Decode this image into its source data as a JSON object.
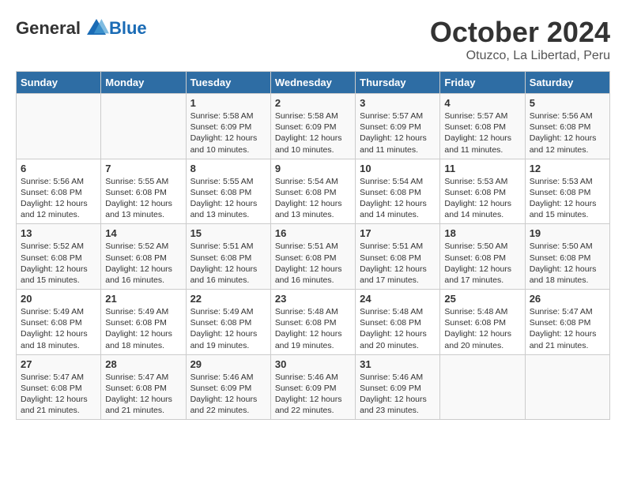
{
  "header": {
    "logo_general": "General",
    "logo_blue": "Blue",
    "month": "October 2024",
    "location": "Otuzco, La Libertad, Peru"
  },
  "days_of_week": [
    "Sunday",
    "Monday",
    "Tuesday",
    "Wednesday",
    "Thursday",
    "Friday",
    "Saturday"
  ],
  "weeks": [
    [
      {
        "day": "",
        "content": ""
      },
      {
        "day": "",
        "content": ""
      },
      {
        "day": "1",
        "content": "Sunrise: 5:58 AM\nSunset: 6:09 PM\nDaylight: 12 hours and 10 minutes."
      },
      {
        "day": "2",
        "content": "Sunrise: 5:58 AM\nSunset: 6:09 PM\nDaylight: 12 hours and 10 minutes."
      },
      {
        "day": "3",
        "content": "Sunrise: 5:57 AM\nSunset: 6:09 PM\nDaylight: 12 hours and 11 minutes."
      },
      {
        "day": "4",
        "content": "Sunrise: 5:57 AM\nSunset: 6:08 PM\nDaylight: 12 hours and 11 minutes."
      },
      {
        "day": "5",
        "content": "Sunrise: 5:56 AM\nSunset: 6:08 PM\nDaylight: 12 hours and 12 minutes."
      }
    ],
    [
      {
        "day": "6",
        "content": "Sunrise: 5:56 AM\nSunset: 6:08 PM\nDaylight: 12 hours and 12 minutes."
      },
      {
        "day": "7",
        "content": "Sunrise: 5:55 AM\nSunset: 6:08 PM\nDaylight: 12 hours and 13 minutes."
      },
      {
        "day": "8",
        "content": "Sunrise: 5:55 AM\nSunset: 6:08 PM\nDaylight: 12 hours and 13 minutes."
      },
      {
        "day": "9",
        "content": "Sunrise: 5:54 AM\nSunset: 6:08 PM\nDaylight: 12 hours and 13 minutes."
      },
      {
        "day": "10",
        "content": "Sunrise: 5:54 AM\nSunset: 6:08 PM\nDaylight: 12 hours and 14 minutes."
      },
      {
        "day": "11",
        "content": "Sunrise: 5:53 AM\nSunset: 6:08 PM\nDaylight: 12 hours and 14 minutes."
      },
      {
        "day": "12",
        "content": "Sunrise: 5:53 AM\nSunset: 6:08 PM\nDaylight: 12 hours and 15 minutes."
      }
    ],
    [
      {
        "day": "13",
        "content": "Sunrise: 5:52 AM\nSunset: 6:08 PM\nDaylight: 12 hours and 15 minutes."
      },
      {
        "day": "14",
        "content": "Sunrise: 5:52 AM\nSunset: 6:08 PM\nDaylight: 12 hours and 16 minutes."
      },
      {
        "day": "15",
        "content": "Sunrise: 5:51 AM\nSunset: 6:08 PM\nDaylight: 12 hours and 16 minutes."
      },
      {
        "day": "16",
        "content": "Sunrise: 5:51 AM\nSunset: 6:08 PM\nDaylight: 12 hours and 16 minutes."
      },
      {
        "day": "17",
        "content": "Sunrise: 5:51 AM\nSunset: 6:08 PM\nDaylight: 12 hours and 17 minutes."
      },
      {
        "day": "18",
        "content": "Sunrise: 5:50 AM\nSunset: 6:08 PM\nDaylight: 12 hours and 17 minutes."
      },
      {
        "day": "19",
        "content": "Sunrise: 5:50 AM\nSunset: 6:08 PM\nDaylight: 12 hours and 18 minutes."
      }
    ],
    [
      {
        "day": "20",
        "content": "Sunrise: 5:49 AM\nSunset: 6:08 PM\nDaylight: 12 hours and 18 minutes."
      },
      {
        "day": "21",
        "content": "Sunrise: 5:49 AM\nSunset: 6:08 PM\nDaylight: 12 hours and 18 minutes."
      },
      {
        "day": "22",
        "content": "Sunrise: 5:49 AM\nSunset: 6:08 PM\nDaylight: 12 hours and 19 minutes."
      },
      {
        "day": "23",
        "content": "Sunrise: 5:48 AM\nSunset: 6:08 PM\nDaylight: 12 hours and 19 minutes."
      },
      {
        "day": "24",
        "content": "Sunrise: 5:48 AM\nSunset: 6:08 PM\nDaylight: 12 hours and 20 minutes."
      },
      {
        "day": "25",
        "content": "Sunrise: 5:48 AM\nSunset: 6:08 PM\nDaylight: 12 hours and 20 minutes."
      },
      {
        "day": "26",
        "content": "Sunrise: 5:47 AM\nSunset: 6:08 PM\nDaylight: 12 hours and 21 minutes."
      }
    ],
    [
      {
        "day": "27",
        "content": "Sunrise: 5:47 AM\nSunset: 6:08 PM\nDaylight: 12 hours and 21 minutes."
      },
      {
        "day": "28",
        "content": "Sunrise: 5:47 AM\nSunset: 6:08 PM\nDaylight: 12 hours and 21 minutes."
      },
      {
        "day": "29",
        "content": "Sunrise: 5:46 AM\nSunset: 6:09 PM\nDaylight: 12 hours and 22 minutes."
      },
      {
        "day": "30",
        "content": "Sunrise: 5:46 AM\nSunset: 6:09 PM\nDaylight: 12 hours and 22 minutes."
      },
      {
        "day": "31",
        "content": "Sunrise: 5:46 AM\nSunset: 6:09 PM\nDaylight: 12 hours and 23 minutes."
      },
      {
        "day": "",
        "content": ""
      },
      {
        "day": "",
        "content": ""
      }
    ]
  ]
}
